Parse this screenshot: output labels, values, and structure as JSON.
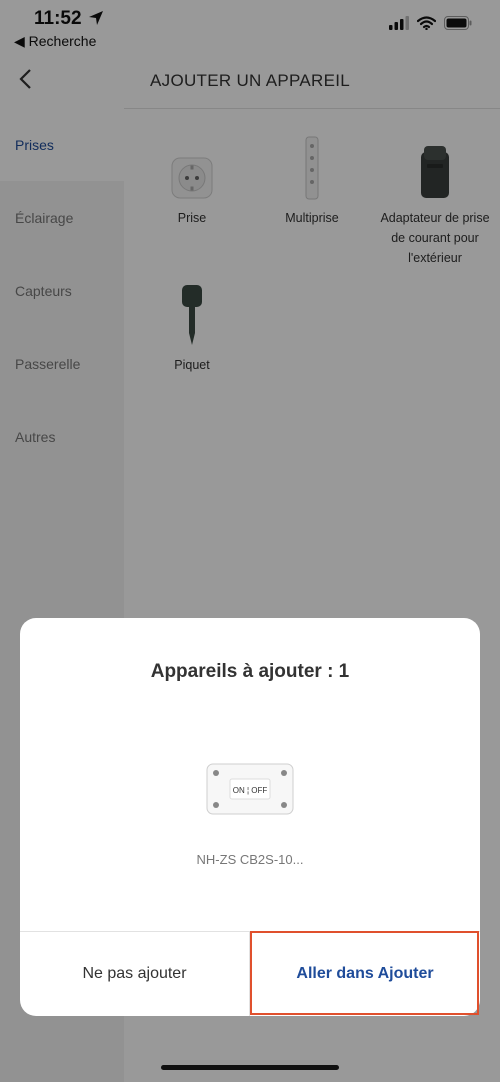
{
  "status_bar": {
    "time": "11:52",
    "back_app": "◀ Recherche"
  },
  "header": {
    "title": "AJOUTER UN APPAREIL"
  },
  "sidebar": {
    "items": [
      {
        "label": "Prises"
      },
      {
        "label": "Éclairage"
      },
      {
        "label": "Capteurs"
      },
      {
        "label": "Passerelle"
      },
      {
        "label": "Autres"
      }
    ],
    "active_index": 0
  },
  "products": [
    {
      "label": "Prise",
      "icon": "socket-plug-icon"
    },
    {
      "label": "Multiprise",
      "icon": "power-strip-icon"
    },
    {
      "label": "Adaptateur de prise de courant pour l'extérieur",
      "icon": "outdoor-adapter-icon"
    },
    {
      "label": "Piquet",
      "icon": "garden-stake-icon"
    }
  ],
  "dialog": {
    "title": "Appareils à ajouter : 1",
    "device_name": "NH-ZS CB2S-10...",
    "device_switch_text": "ON ¦ OFF",
    "cancel_label": "Ne pas ajouter",
    "confirm_label": "Aller dans Ajouter"
  },
  "colors": {
    "accent": "#1f4c9a",
    "highlight": "#e0502d",
    "overlay": "rgba(0,0,0,0.4)"
  }
}
